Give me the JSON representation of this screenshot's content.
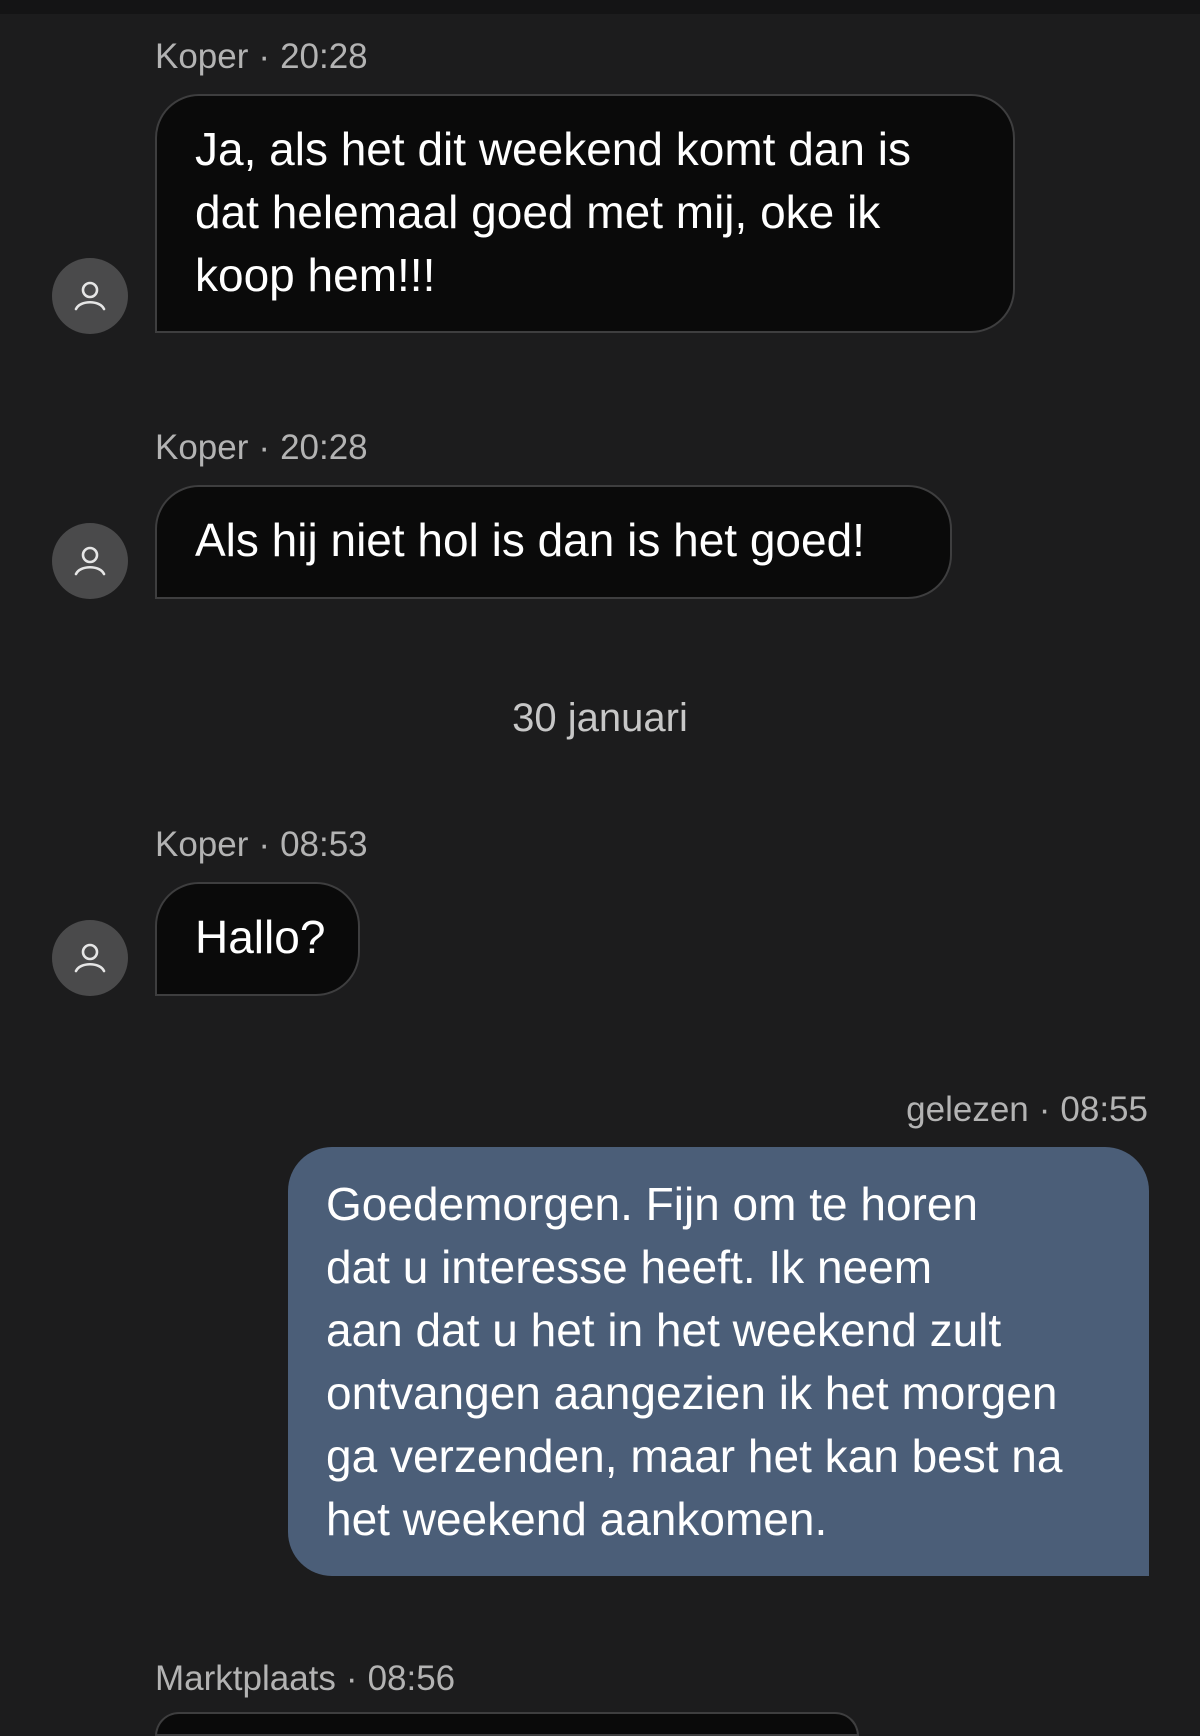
{
  "conversation": {
    "messages": [
      {
        "sender": "Koper",
        "time": "20:28",
        "text": "Ja, als het dit weekend komt dan is\ndat helemaal goed met mij, oke ik\nkoop hem!!!"
      },
      {
        "sender": "Koper",
        "time": "20:28",
        "text": "Als hij niet hol is dan is het goed!"
      },
      {
        "date_separator": "30 januari"
      },
      {
        "sender": "Koper",
        "time": "08:53",
        "text": "Hallo?"
      },
      {
        "status": "gelezen",
        "time": "08:55",
        "text": "Goedemorgen. Fijn om te horen\ndat u interesse heeft. Ik neem\naan dat u het in het weekend zult\nontvangen aangezien ik het morgen\nga verzenden, maar het kan best na\nhet weekend aankomen."
      },
      {
        "sender": "Marktplaats",
        "time": "08:56"
      }
    ],
    "separator_dot": "·"
  },
  "icons": {
    "avatar": "user-icon"
  },
  "colors": {
    "background": "#1c1c1d",
    "incoming_bubble": "#0a0a0a",
    "outgoing_bubble": "#4b5e78",
    "avatar": "#4a4a4b"
  }
}
